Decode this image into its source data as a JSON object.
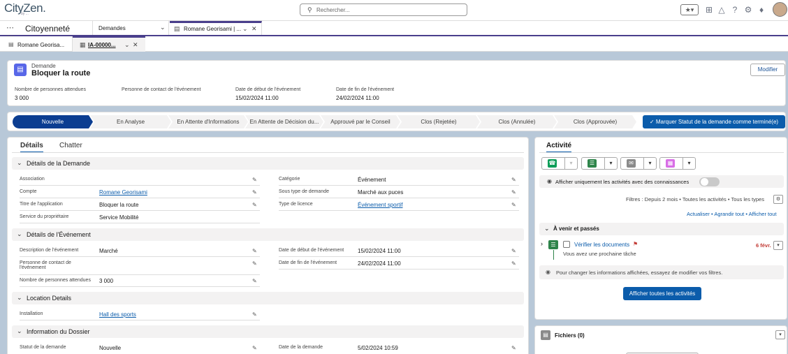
{
  "header": {
    "logo": "CityZen.",
    "logo_sub": "by ...",
    "search_placeholder": "Rechercher..."
  },
  "nav": {
    "app_name": "Citoyenneté",
    "menu_label": "Demandes",
    "tab_label": "Romane Georisami | ..."
  },
  "subtabs": {
    "first": "Romane Georisa...",
    "second": "IA-00000..."
  },
  "record": {
    "type": "Demande",
    "title": "Bloquer la route",
    "edit_button": "Modifier",
    "fields": [
      {
        "label": "Nombre de personnes attendues",
        "value": "3 000"
      },
      {
        "label": "Personne de contact de l'événement",
        "value": ""
      },
      {
        "label": "Date de début de l'événement",
        "value": "15/02/2024 11:00"
      },
      {
        "label": "Date de fin de l'événement",
        "value": "24/02/2024 11:00"
      }
    ]
  },
  "path": {
    "steps": [
      "Nouvelle",
      "En Analyse",
      "En Attente d'Informations",
      "En Attente de Décision du...",
      "Approuvé par le Conseil",
      "Clos (Rejetée)",
      "Clos (Annulée)",
      "Clos (Approuvée)"
    ],
    "active_index": 0,
    "mark_button": "Marquer Statut de la demande comme terminé(e)"
  },
  "details": {
    "tab_details": "Détails",
    "tab_chatter": "Chatter",
    "sec1": {
      "title": "Détails de la Demande",
      "left": [
        {
          "label": "Association",
          "value": ""
        },
        {
          "label": "Compte",
          "value": "Romane Georisami"
        },
        {
          "label": "Titre de l'application",
          "value": "Bloquer la route"
        },
        {
          "label": "Service du propriétaire",
          "value": "Service Mobilité"
        }
      ],
      "right": [
        {
          "label": "Catégorie",
          "value": "Événement"
        },
        {
          "label": "Sous type de demande",
          "value": "Marché aux puces"
        },
        {
          "label": "Type de licence",
          "value": "Événement sportif"
        }
      ]
    },
    "sec2": {
      "title": "Détails de l'Événement",
      "left": [
        {
          "label": "Description de l'événement",
          "value": "Marché"
        },
        {
          "label": "Personne de contact de l'événement",
          "value": ""
        },
        {
          "label": "Nombre de personnes attendues",
          "value": "3 000"
        }
      ],
      "right": [
        {
          "label": "Date de début de l'événement",
          "value": "15/02/2024 11:00"
        },
        {
          "label": "Date de fin de l'événement",
          "value": "24/02/2024 11:00"
        }
      ]
    },
    "sec3": {
      "title": "Location Details",
      "left": [
        {
          "label": "Installation",
          "value": "Hall des sports"
        }
      ]
    },
    "sec4": {
      "title": "Information du Dossier",
      "left": [
        {
          "label": "Statut de la demande",
          "value": "Nouvelle"
        }
      ],
      "right": [
        {
          "label": "Date de la demande",
          "value": "5/02/2024 10:59"
        }
      ]
    }
  },
  "activity": {
    "title": "Activité",
    "knowledge_label": "Afficher uniquement les activités avec des connaissances",
    "filters": "Filtres : Depuis 2 mois • Toutes les activités • Tous les types",
    "links": [
      "Actualiser",
      "Agrandir tout",
      "Afficher tout"
    ],
    "section": "À venir et passés",
    "task_title": "Vérifier les documents",
    "task_date": "6 févr.",
    "task_sub": "Vous avez une prochaine tâche",
    "info": "Pour changer les informations affichées, essayez de modifier vos filtres.",
    "show_all_button": "Afficher toutes les activités"
  },
  "files": {
    "title": "Fichiers (0)"
  },
  "colors": {
    "brand": "#0b5cab",
    "path_active": "#0b3d91",
    "nav_accent": "#4a3f8c"
  }
}
